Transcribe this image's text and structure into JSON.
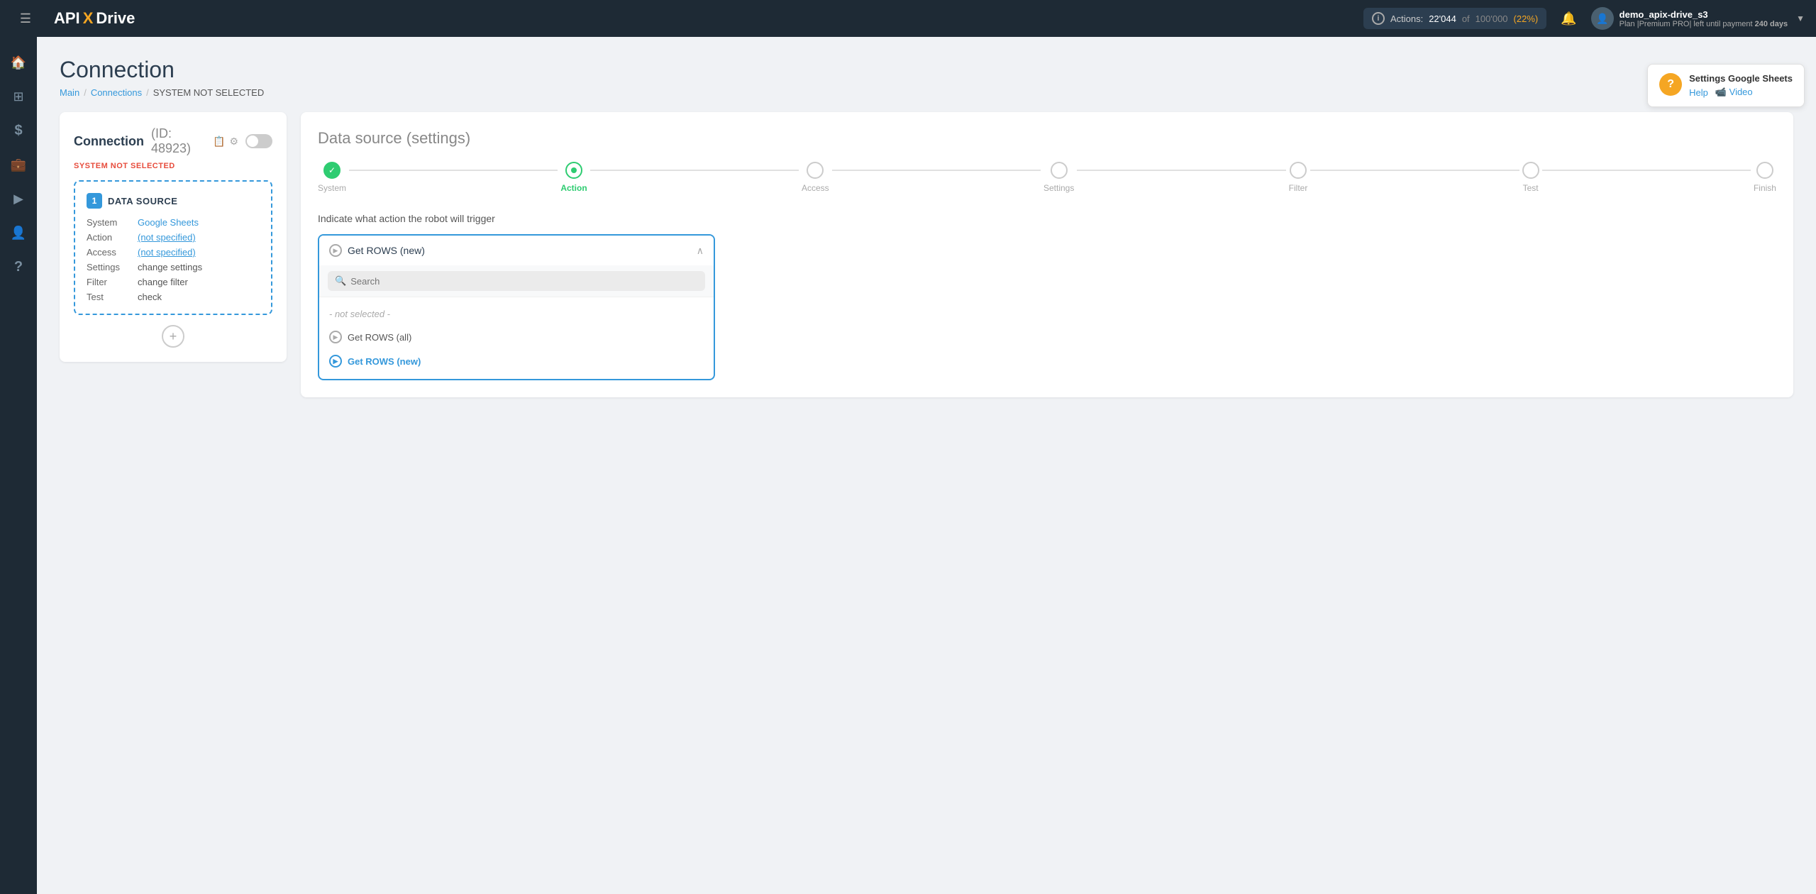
{
  "topnav": {
    "logo": {
      "api": "API",
      "x": "X",
      "drive": "Drive"
    },
    "actions_label": "Actions:",
    "actions_count": "22'044",
    "actions_of": "of",
    "actions_limit": "100'000",
    "actions_pct": "(22%)",
    "bell_icon": "🔔",
    "username": "demo_apix-drive_s3",
    "plan_label": "Plan |Premium PRO| left until payment",
    "plan_days": "240 days",
    "chevron": "▼"
  },
  "sidebar": {
    "items": [
      {
        "icon": "☰",
        "name": "menu",
        "active": false
      },
      {
        "icon": "⊞",
        "name": "dashboard",
        "active": false
      },
      {
        "icon": "⛛",
        "name": "connections",
        "active": false
      },
      {
        "icon": "$",
        "name": "billing",
        "active": false
      },
      {
        "icon": "💼",
        "name": "services",
        "active": false
      },
      {
        "icon": "▶",
        "name": "youtube",
        "active": false
      },
      {
        "icon": "👤",
        "name": "profile",
        "active": false
      },
      {
        "icon": "?",
        "name": "help",
        "active": false
      }
    ]
  },
  "breadcrumb": {
    "main": "Main",
    "connections": "Connections",
    "separator": "/",
    "current": "SYSTEM NOT SELECTED"
  },
  "page_title": "Connection",
  "help": {
    "title": "Settings Google Sheets",
    "help_link": "Help",
    "video_link": "📹 Video"
  },
  "left_panel": {
    "title": "Connection",
    "id_label": "(ID: 48923)",
    "status": "SYSTEM NOT SELECTED",
    "datasource": {
      "number": "1",
      "label": "DATA SOURCE",
      "rows": [
        {
          "label": "System",
          "value": "Google Sheets",
          "is_link": true
        },
        {
          "label": "Action",
          "value": "(not specified)",
          "is_link": true
        },
        {
          "label": "Access",
          "value": "(not specified)",
          "is_link": true
        },
        {
          "label": "Settings",
          "value": "change settings",
          "is_link": false
        },
        {
          "label": "Filter",
          "value": "change filter",
          "is_link": false
        },
        {
          "label": "Test",
          "value": "check",
          "is_link": false
        }
      ]
    },
    "add_btn": "+"
  },
  "right_panel": {
    "title": "Data source",
    "title_sub": "(settings)",
    "stepper": [
      {
        "label": "System",
        "state": "done"
      },
      {
        "label": "Action",
        "state": "active"
      },
      {
        "label": "Access",
        "state": "empty"
      },
      {
        "label": "Settings",
        "state": "empty"
      },
      {
        "label": "Filter",
        "state": "empty"
      },
      {
        "label": "Test",
        "state": "empty"
      },
      {
        "label": "Finish",
        "state": "empty"
      }
    ],
    "action_prompt": "Indicate what action the robot will trigger",
    "dropdown": {
      "selected": "Get ROWS (new)",
      "search_placeholder": "Search",
      "not_selected_label": "- not selected -",
      "options": [
        {
          "label": "Get ROWS (all)",
          "selected": false
        },
        {
          "label": "Get ROWS (new)",
          "selected": true
        }
      ]
    }
  }
}
